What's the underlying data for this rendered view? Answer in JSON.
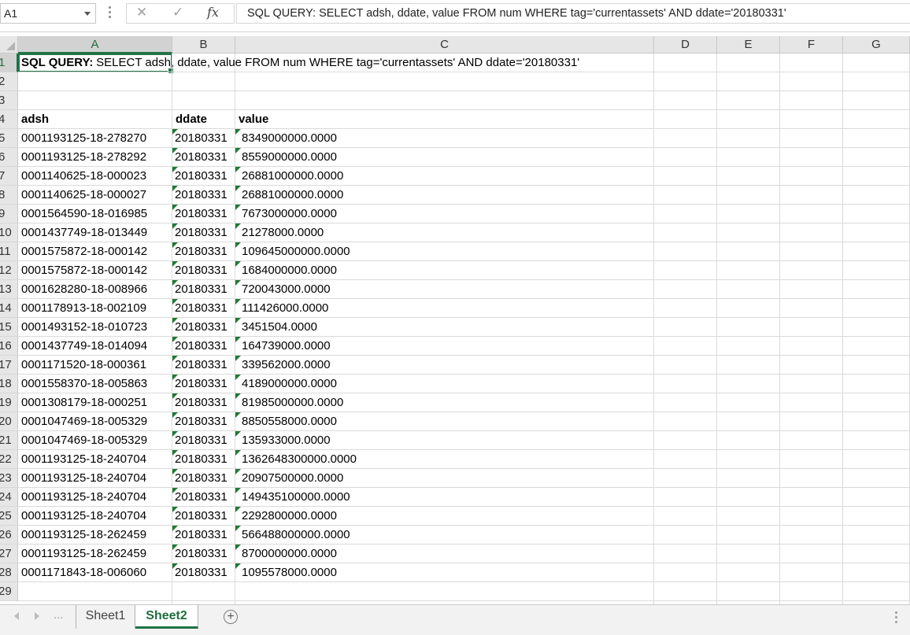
{
  "formula_bar": {
    "name_box": "A1",
    "fx_label": "fx",
    "cancel_icon": "✕",
    "enter_icon": "✓",
    "content": "SQL QUERY: SELECT adsh, ddate, value FROM num WHERE tag='currentassets' AND ddate='20180331'"
  },
  "columns": [
    "A",
    "B",
    "C",
    "D",
    "E",
    "F",
    "G"
  ],
  "row_numbers": [
    "1",
    "2",
    "3",
    "4",
    "5",
    "6",
    "7",
    "8",
    "9",
    "10",
    "11",
    "12",
    "13",
    "14",
    "15",
    "16",
    "17",
    "18",
    "19",
    "20",
    "21",
    "22",
    "23",
    "24",
    "25",
    "26",
    "27",
    "28",
    "29"
  ],
  "cells": {
    "a1_label": "SQL QUERY:",
    "a1_query": " SELECT adsh, ddate, value FROM num WHERE tag='currentassets' AND ddate='20180331'",
    "headers": {
      "adsh": "adsh",
      "ddate": "ddate",
      "value": "value"
    },
    "rows": [
      [
        "0001193125-18-278270",
        "20180331",
        "8349000000.0000"
      ],
      [
        "0001193125-18-278292",
        "20180331",
        "8559000000.0000"
      ],
      [
        "0001140625-18-000023",
        "20180331",
        "26881000000.0000"
      ],
      [
        "0001140625-18-000027",
        "20180331",
        "26881000000.0000"
      ],
      [
        "0001564590-18-016985",
        "20180331",
        "7673000000.0000"
      ],
      [
        "0001437749-18-013449",
        "20180331",
        "21278000.0000"
      ],
      [
        "0001575872-18-000142",
        "20180331",
        "109645000000.0000"
      ],
      [
        "0001575872-18-000142",
        "20180331",
        "1684000000.0000"
      ],
      [
        "0001628280-18-008966",
        "20180331",
        "720043000.0000"
      ],
      [
        "0001178913-18-002109",
        "20180331",
        "111426000.0000"
      ],
      [
        "0001493152-18-010723",
        "20180331",
        "3451504.0000"
      ],
      [
        "0001437749-18-014094",
        "20180331",
        "164739000.0000"
      ],
      [
        "0001171520-18-000361",
        "20180331",
        "339562000.0000"
      ],
      [
        "0001558370-18-005863",
        "20180331",
        "4189000000.0000"
      ],
      [
        "0001308179-18-000251",
        "20180331",
        "81985000000.0000"
      ],
      [
        "0001047469-18-005329",
        "20180331",
        "8850558000.0000"
      ],
      [
        "0001047469-18-005329",
        "20180331",
        "135933000.0000"
      ],
      [
        "0001193125-18-240704",
        "20180331",
        "1362648300000.0000"
      ],
      [
        "0001193125-18-240704",
        "20180331",
        "20907500000.0000"
      ],
      [
        "0001193125-18-240704",
        "20180331",
        "149435100000.0000"
      ],
      [
        "0001193125-18-240704",
        "20180331",
        "2292800000.0000"
      ],
      [
        "0001193125-18-262459",
        "20180331",
        "566488000000.0000"
      ],
      [
        "0001193125-18-262459",
        "20180331",
        "8700000000.0000"
      ],
      [
        "0001171843-18-006060",
        "20180331",
        "1095578000.0000"
      ]
    ]
  },
  "sheet_tabs": {
    "tabs": [
      "Sheet1",
      "Sheet2"
    ],
    "active": "Sheet2",
    "ellipsis": "...",
    "add_label": "+"
  },
  "colors": {
    "accent": "#217346",
    "number_stored_as_text_marker": "#1e7a34"
  }
}
